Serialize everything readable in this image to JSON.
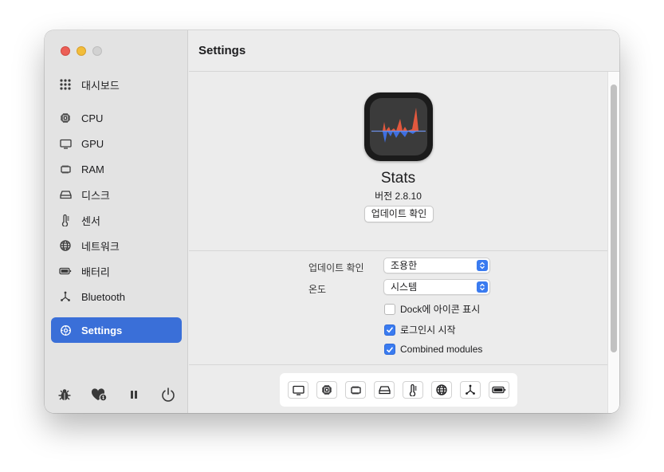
{
  "window": {
    "traffic_lights": {
      "close_color": "#ec5f57",
      "minimize_color": "#f2bd3a",
      "zoom_color": "#d2d2d2"
    }
  },
  "sidebar": {
    "items": [
      {
        "label": "대시보드",
        "icon": "grid-icon"
      },
      {
        "label": "CPU",
        "icon": "cpu-icon"
      },
      {
        "label": "GPU",
        "icon": "gpu-icon"
      },
      {
        "label": "RAM",
        "icon": "ram-icon"
      },
      {
        "label": "디스크",
        "icon": "disk-icon"
      },
      {
        "label": "센서",
        "icon": "thermometer-icon"
      },
      {
        "label": "네트워크",
        "icon": "globe-icon"
      },
      {
        "label": "배터리",
        "icon": "battery-icon"
      },
      {
        "label": "Bluetooth",
        "icon": "bluetooth-icon"
      },
      {
        "label": "Settings",
        "icon": "gear-icon",
        "active": true
      }
    ],
    "bottom_icons": [
      "bug-icon",
      "heart-donate-icon",
      "pause-icon",
      "power-icon"
    ],
    "accent_color": "#3a6fd8"
  },
  "header": {
    "title": "Settings"
  },
  "about": {
    "app_name": "Stats",
    "version": "버전 2.8.10",
    "update_button": "업데이트 확인"
  },
  "settings": {
    "update_label": "업데이트 확인",
    "update_value": "조용한",
    "temperature_label": "온도",
    "temperature_value": "시스템",
    "checkboxes": [
      {
        "label": "Dock에 아이콘 표시",
        "checked": false
      },
      {
        "label": "로그인시 시작",
        "checked": true
      },
      {
        "label": "Combined modules",
        "checked": true
      }
    ]
  },
  "modules": [
    "gpu-icon",
    "cpu-icon",
    "ram-icon",
    "disk-icon",
    "sensors-icon",
    "network-icon",
    "bluetooth-icon",
    "battery-icon"
  ]
}
